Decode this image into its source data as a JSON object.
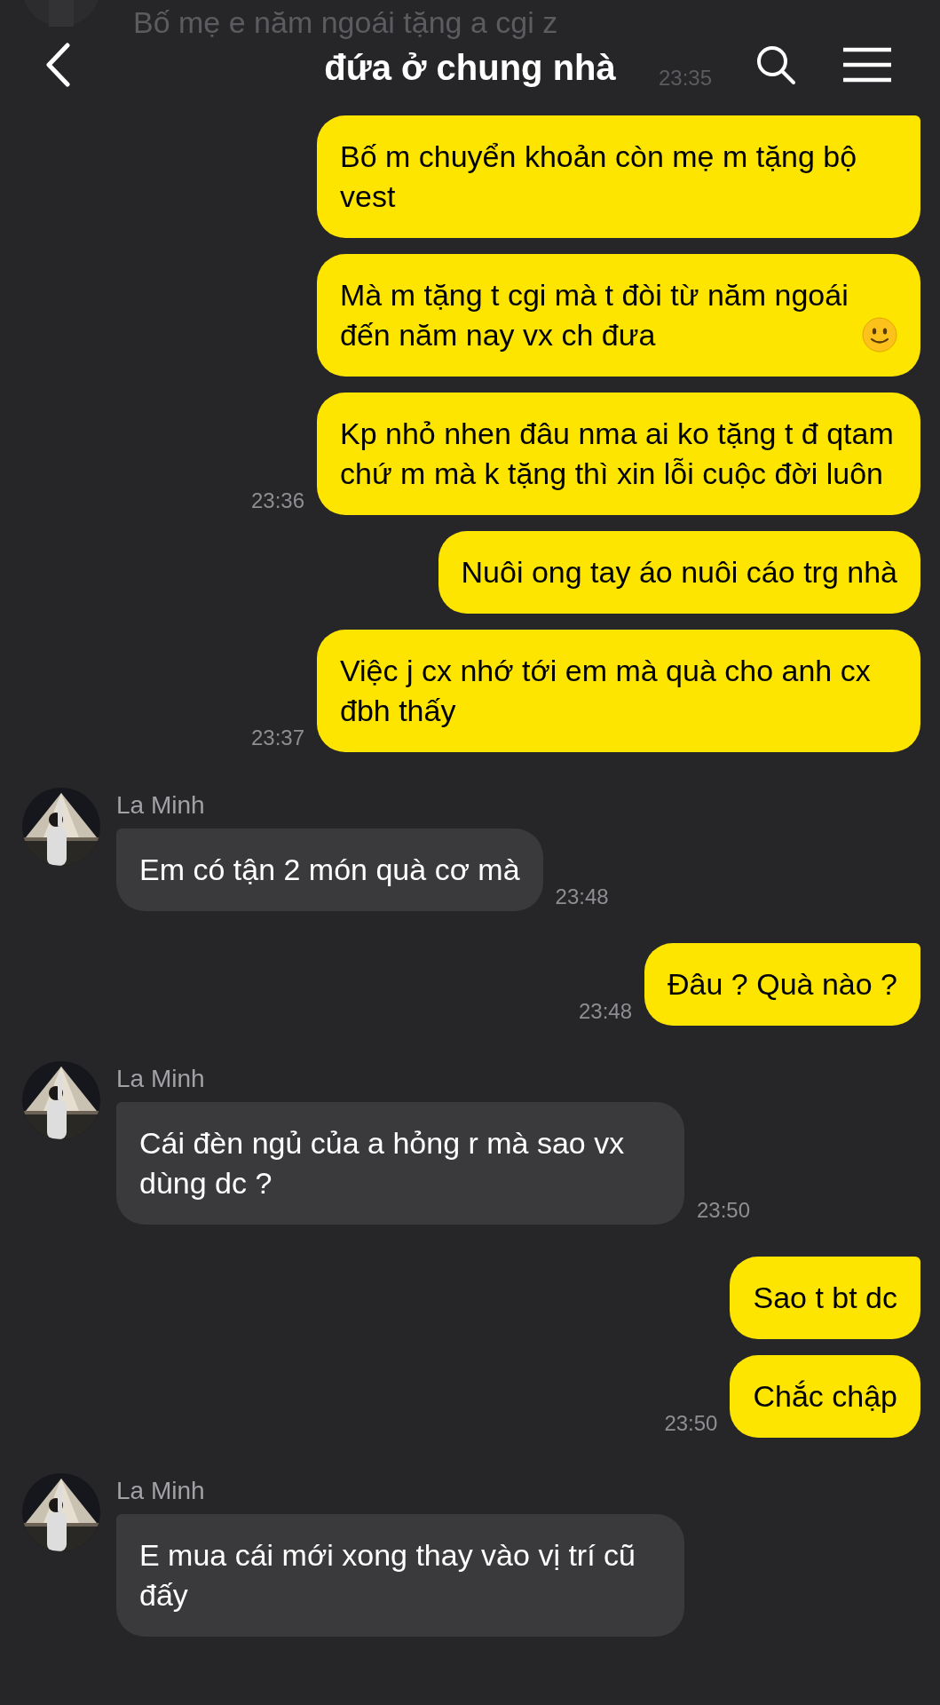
{
  "header": {
    "title": "đứa ở chung nhà"
  },
  "scrolled_under": {
    "text": "Bố mẹ e năm ngoái tặng a cgi z",
    "time": "23:35"
  },
  "messages": [
    {
      "kind": "sent",
      "text": "Bố m chuyển khoản còn mẹ m tặng bộ vest",
      "tail": true
    },
    {
      "kind": "sent",
      "text": "Mà m tặng t cgi mà t đòi từ năm ngoái đến năm nay vx ch đưa",
      "emoji": true,
      "tail": false
    },
    {
      "kind": "sent",
      "text": "Kp nhỏ nhen đâu nma ai ko tặng t đ qtam chứ m mà k tặng thì xin lỗi cuộc đời luôn",
      "tail": false,
      "time": "23:36"
    },
    {
      "kind": "sent",
      "text": "Nuôi ong tay áo nuôi cáo trg nhà",
      "tail": false
    },
    {
      "kind": "sent",
      "text": "Việc j cx nhớ tới em mà quà cho anh cx đbh thấy",
      "tail": false,
      "time": "23:37"
    },
    {
      "kind": "received",
      "sender": "La Minh",
      "text": "Em có tận 2 món quà cơ mà",
      "tail": true,
      "time": "23:48"
    },
    {
      "kind": "sent",
      "text": "Đâu ? Quà nào ?",
      "tail": true,
      "time": "23:48"
    },
    {
      "kind": "received",
      "sender": "La Minh",
      "text": "Cái đèn ngủ của a hỏng r mà sao vx dùng dc ?",
      "tail": true,
      "time": "23:50"
    },
    {
      "kind": "sent",
      "text": "Sao t bt dc",
      "tail": true
    },
    {
      "kind": "sent",
      "text": "Chắc chập",
      "tail": false,
      "time": "23:50"
    },
    {
      "kind": "received",
      "sender": "La Minh",
      "text": "E mua cái mới xong thay vào vị trí cũ đấy",
      "tail": true
    }
  ]
}
